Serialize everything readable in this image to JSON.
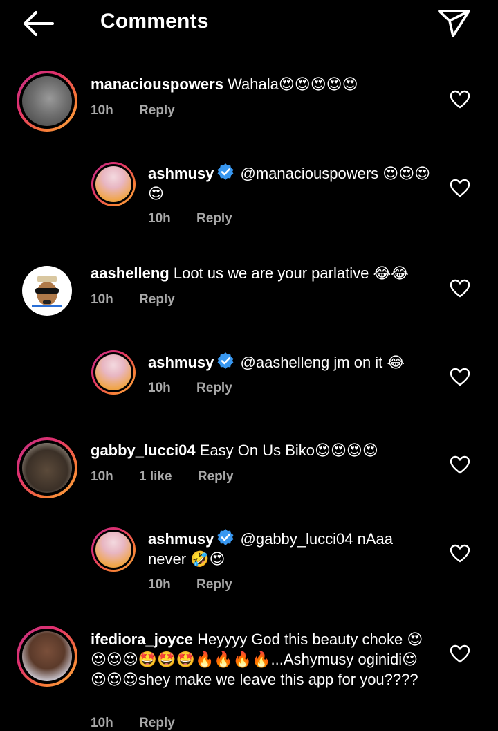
{
  "header": {
    "title": "Comments",
    "back_icon": "arrow-left-icon",
    "share_icon": "send-paper-plane-icon"
  },
  "comments": [
    {
      "username": "manaciouspowers",
      "text": "Wahala😍😍😍😍😍",
      "time": "10h",
      "reply_label": "Reply",
      "like_icon": "heart-outline-icon"
    },
    {
      "username": "ashmusy",
      "verified": true,
      "text": "@manaciouspowers 😍😍😍😍",
      "time": "10h",
      "reply_label": "Reply",
      "like_icon": "heart-outline-icon"
    },
    {
      "username": "aashelleng",
      "text": "Loot us we are your parlative 😂😂",
      "time": "10h",
      "reply_label": "Reply",
      "like_icon": "heart-outline-icon"
    },
    {
      "username": "ashmusy",
      "verified": true,
      "text": "@aashelleng jm on it 😂",
      "time": "10h",
      "reply_label": "Reply",
      "like_icon": "heart-outline-icon"
    },
    {
      "username": "gabby_lucci04",
      "text": "Easy On Us Biko😍😍😍😍",
      "time": "10h",
      "likes": "1 like",
      "reply_label": "Reply",
      "like_icon": "heart-outline-icon"
    },
    {
      "username": "ashmusy",
      "verified": true,
      "text": "@gabby_lucci04 nAaa never 🤣😍",
      "time": "10h",
      "reply_label": "Reply",
      "like_icon": "heart-outline-icon"
    },
    {
      "username": "ifediora_joyce",
      "text": "Heyyyy God this beauty choke 😍😍😍😍🤩🤩🤩🔥🔥🔥🔥...Ashymusy oginidi😍😍😍😍shey make we leave this app for you????",
      "time": "10h",
      "reply_label": "Reply",
      "like_icon": "heart-outline-icon"
    }
  ],
  "colors": {
    "background": "#000000",
    "text": "#ffffff",
    "meta": "#a8a8a8",
    "verified": "#3897f0"
  }
}
